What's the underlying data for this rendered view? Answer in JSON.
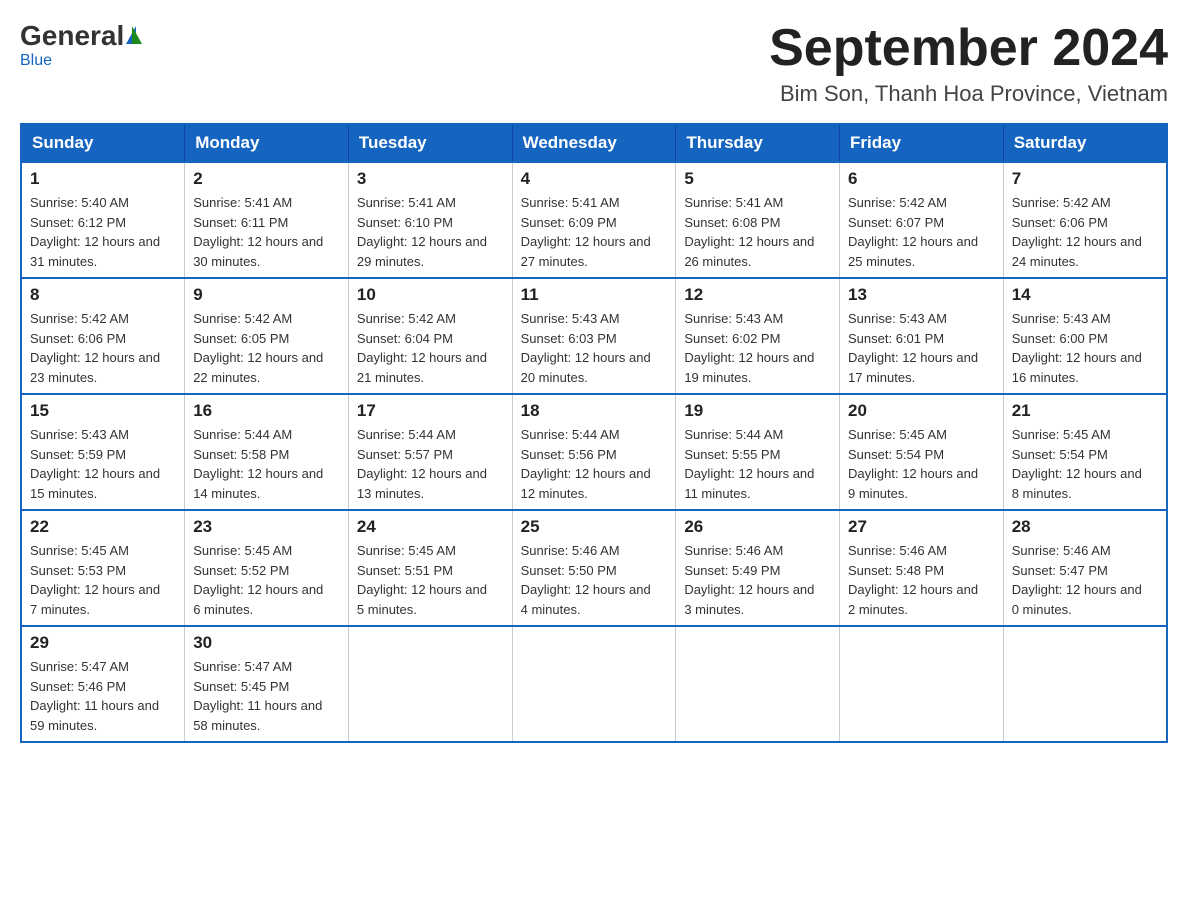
{
  "header": {
    "logo_general": "General",
    "logo_blue": "Blue",
    "month_year": "September 2024",
    "location": "Bim Son, Thanh Hoa Province, Vietnam"
  },
  "columns": [
    "Sunday",
    "Monday",
    "Tuesday",
    "Wednesday",
    "Thursday",
    "Friday",
    "Saturday"
  ],
  "weeks": [
    [
      {
        "day": "1",
        "sunrise": "5:40 AM",
        "sunset": "6:12 PM",
        "daylight": "12 hours and 31 minutes."
      },
      {
        "day": "2",
        "sunrise": "5:41 AM",
        "sunset": "6:11 PM",
        "daylight": "12 hours and 30 minutes."
      },
      {
        "day": "3",
        "sunrise": "5:41 AM",
        "sunset": "6:10 PM",
        "daylight": "12 hours and 29 minutes."
      },
      {
        "day": "4",
        "sunrise": "5:41 AM",
        "sunset": "6:09 PM",
        "daylight": "12 hours and 27 minutes."
      },
      {
        "day": "5",
        "sunrise": "5:41 AM",
        "sunset": "6:08 PM",
        "daylight": "12 hours and 26 minutes."
      },
      {
        "day": "6",
        "sunrise": "5:42 AM",
        "sunset": "6:07 PM",
        "daylight": "12 hours and 25 minutes."
      },
      {
        "day": "7",
        "sunrise": "5:42 AM",
        "sunset": "6:06 PM",
        "daylight": "12 hours and 24 minutes."
      }
    ],
    [
      {
        "day": "8",
        "sunrise": "5:42 AM",
        "sunset": "6:06 PM",
        "daylight": "12 hours and 23 minutes."
      },
      {
        "day": "9",
        "sunrise": "5:42 AM",
        "sunset": "6:05 PM",
        "daylight": "12 hours and 22 minutes."
      },
      {
        "day": "10",
        "sunrise": "5:42 AM",
        "sunset": "6:04 PM",
        "daylight": "12 hours and 21 minutes."
      },
      {
        "day": "11",
        "sunrise": "5:43 AM",
        "sunset": "6:03 PM",
        "daylight": "12 hours and 20 minutes."
      },
      {
        "day": "12",
        "sunrise": "5:43 AM",
        "sunset": "6:02 PM",
        "daylight": "12 hours and 19 minutes."
      },
      {
        "day": "13",
        "sunrise": "5:43 AM",
        "sunset": "6:01 PM",
        "daylight": "12 hours and 17 minutes."
      },
      {
        "day": "14",
        "sunrise": "5:43 AM",
        "sunset": "6:00 PM",
        "daylight": "12 hours and 16 minutes."
      }
    ],
    [
      {
        "day": "15",
        "sunrise": "5:43 AM",
        "sunset": "5:59 PM",
        "daylight": "12 hours and 15 minutes."
      },
      {
        "day": "16",
        "sunrise": "5:44 AM",
        "sunset": "5:58 PM",
        "daylight": "12 hours and 14 minutes."
      },
      {
        "day": "17",
        "sunrise": "5:44 AM",
        "sunset": "5:57 PM",
        "daylight": "12 hours and 13 minutes."
      },
      {
        "day": "18",
        "sunrise": "5:44 AM",
        "sunset": "5:56 PM",
        "daylight": "12 hours and 12 minutes."
      },
      {
        "day": "19",
        "sunrise": "5:44 AM",
        "sunset": "5:55 PM",
        "daylight": "12 hours and 11 minutes."
      },
      {
        "day": "20",
        "sunrise": "5:45 AM",
        "sunset": "5:54 PM",
        "daylight": "12 hours and 9 minutes."
      },
      {
        "day": "21",
        "sunrise": "5:45 AM",
        "sunset": "5:54 PM",
        "daylight": "12 hours and 8 minutes."
      }
    ],
    [
      {
        "day": "22",
        "sunrise": "5:45 AM",
        "sunset": "5:53 PM",
        "daylight": "12 hours and 7 minutes."
      },
      {
        "day": "23",
        "sunrise": "5:45 AM",
        "sunset": "5:52 PM",
        "daylight": "12 hours and 6 minutes."
      },
      {
        "day": "24",
        "sunrise": "5:45 AM",
        "sunset": "5:51 PM",
        "daylight": "12 hours and 5 minutes."
      },
      {
        "day": "25",
        "sunrise": "5:46 AM",
        "sunset": "5:50 PM",
        "daylight": "12 hours and 4 minutes."
      },
      {
        "day": "26",
        "sunrise": "5:46 AM",
        "sunset": "5:49 PM",
        "daylight": "12 hours and 3 minutes."
      },
      {
        "day": "27",
        "sunrise": "5:46 AM",
        "sunset": "5:48 PM",
        "daylight": "12 hours and 2 minutes."
      },
      {
        "day": "28",
        "sunrise": "5:46 AM",
        "sunset": "5:47 PM",
        "daylight": "12 hours and 0 minutes."
      }
    ],
    [
      {
        "day": "29",
        "sunrise": "5:47 AM",
        "sunset": "5:46 PM",
        "daylight": "11 hours and 59 minutes."
      },
      {
        "day": "30",
        "sunrise": "5:47 AM",
        "sunset": "5:45 PM",
        "daylight": "11 hours and 58 minutes."
      },
      null,
      null,
      null,
      null,
      null
    ]
  ]
}
